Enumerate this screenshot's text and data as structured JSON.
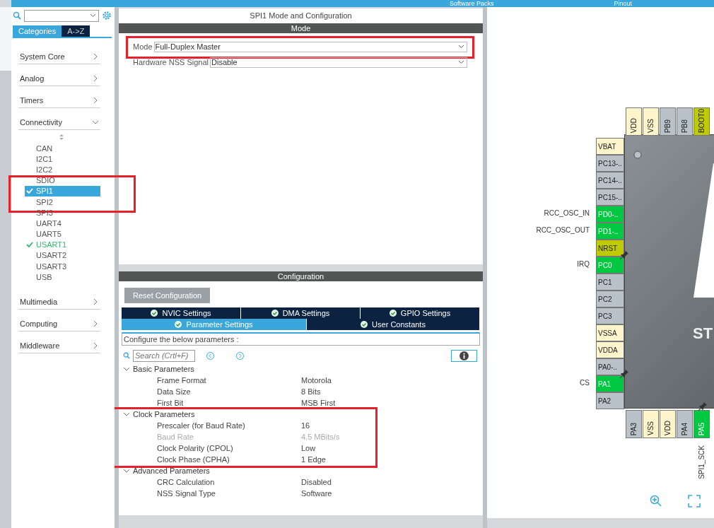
{
  "top_bar": {
    "menus": [
      "Software Packs",
      "Pinout"
    ]
  },
  "sidebar": {
    "tabs": [
      {
        "label": "Categories",
        "selected": true
      },
      {
        "label": "A->Z",
        "selected": false
      }
    ],
    "categories": [
      {
        "label": "System Core",
        "expanded": false
      },
      {
        "label": "Analog",
        "expanded": false
      },
      {
        "label": "Timers",
        "expanded": false
      },
      {
        "label": "Connectivity",
        "expanded": true,
        "children": [
          {
            "label": "CAN",
            "selected": false,
            "checked": false,
            "highlighted": false
          },
          {
            "label": "I2C1",
            "selected": false,
            "checked": false,
            "highlighted": false
          },
          {
            "label": "I2C2",
            "selected": false,
            "checked": false,
            "highlighted": false
          },
          {
            "label": "SDIO",
            "selected": false,
            "checked": false,
            "highlighted": false
          },
          {
            "label": "SPI1",
            "selected": true,
            "checked": true,
            "highlighted": true
          },
          {
            "label": "SPI2",
            "selected": false,
            "checked": false,
            "highlighted": false
          },
          {
            "label": "SPI3",
            "selected": false,
            "checked": false,
            "highlighted": false
          },
          {
            "label": "UART4",
            "selected": false,
            "checked": false,
            "highlighted": false
          },
          {
            "label": "UART5",
            "selected": false,
            "checked": false,
            "highlighted": false
          },
          {
            "label": "USART1",
            "selected": false,
            "checked": true,
            "highlighted": false
          },
          {
            "label": "USART2",
            "selected": false,
            "checked": false,
            "highlighted": false
          },
          {
            "label": "USART3",
            "selected": false,
            "checked": false,
            "highlighted": false
          },
          {
            "label": "USB",
            "selected": false,
            "checked": false,
            "highlighted": false
          }
        ]
      },
      {
        "label": "Multimedia",
        "expanded": false
      },
      {
        "label": "Computing",
        "expanded": false
      },
      {
        "label": "Middleware",
        "expanded": false
      }
    ]
  },
  "panel": {
    "title": "SPI1 Mode and Configuration",
    "mode_header": "Mode",
    "mode_fields": [
      {
        "label": "Mode",
        "value": "Full-Duplex Master",
        "highlighted": true
      },
      {
        "label": "Hardware NSS Signal",
        "value": "Disable",
        "highlighted": false
      }
    ],
    "config_header": "Configuration",
    "reset_button": "Reset Configuration",
    "tab_rows": [
      [
        {
          "label": "NVIC Settings",
          "selected": false
        },
        {
          "label": "DMA Settings",
          "selected": false
        },
        {
          "label": "GPIO Settings",
          "selected": false
        }
      ],
      [
        {
          "label": "Parameter Settings",
          "selected": true
        },
        {
          "label": "User Constants",
          "selected": false
        }
      ]
    ],
    "hint": "Configure the below parameters :",
    "search": {
      "placeholder": "Search (Crtl+F)"
    },
    "groups": [
      {
        "label": "Basic Parameters",
        "expanded": true,
        "highlighted": false,
        "children": [
          {
            "label": "Frame Format",
            "value": "Motorola",
            "disabled": false
          },
          {
            "label": "Data Size",
            "value": "8 Bits",
            "disabled": false
          },
          {
            "label": "First Bit",
            "value": "MSB First",
            "disabled": false
          }
        ]
      },
      {
        "label": "Clock Parameters",
        "expanded": true,
        "highlighted": true,
        "children": [
          {
            "label": "Prescaler (for Baud Rate)",
            "value": "16",
            "disabled": false
          },
          {
            "label": "Baud Rate",
            "value": "4.5 MBits/s",
            "disabled": true
          },
          {
            "label": "Clock Polarity (CPOL)",
            "value": "Low",
            "disabled": false
          },
          {
            "label": "Clock Phase (CPHA)",
            "value": "1 Edge",
            "disabled": false
          }
        ]
      },
      {
        "label": "Advanced Parameters",
        "expanded": true,
        "highlighted": false,
        "children": [
          {
            "label": "CRC Calculation",
            "value": "Disabled",
            "disabled": false
          },
          {
            "label": "NSS Signal Type",
            "value": "Software",
            "disabled": false
          }
        ]
      }
    ]
  },
  "pinout": {
    "chip_text": "ST",
    "top_pins": [
      {
        "label": "VDD",
        "kind": "power"
      },
      {
        "label": "VSS",
        "kind": "power"
      },
      {
        "label": "PB9",
        "kind": "io"
      },
      {
        "label": "PB8",
        "kind": "io"
      },
      {
        "label": "BOOT0",
        "kind": "boot"
      }
    ],
    "left_pins": [
      {
        "label": "VBAT",
        "kind": "power"
      },
      {
        "label": "PC13-..",
        "kind": "io"
      },
      {
        "label": "PC14-..",
        "kind": "io"
      },
      {
        "label": "PC15-..",
        "kind": "io"
      },
      {
        "label": "PD0-..",
        "kind": "used",
        "signal": "RCC_OSC_IN"
      },
      {
        "label": "PD1-..",
        "kind": "used",
        "signal": "RCC_OSC_OUT"
      },
      {
        "label": "NRST",
        "kind": "boot"
      },
      {
        "label": "PC0",
        "kind": "used",
        "signal": "IRQ",
        "pinned": true
      },
      {
        "label": "PC1",
        "kind": "io"
      },
      {
        "label": "PC2",
        "kind": "io"
      },
      {
        "label": "PC3",
        "kind": "io"
      },
      {
        "label": "VSSA",
        "kind": "power"
      },
      {
        "label": "VDDA",
        "kind": "power"
      },
      {
        "label": "PA0-..",
        "kind": "io"
      },
      {
        "label": "PA1",
        "kind": "used",
        "signal": "CS",
        "pinned": true
      },
      {
        "label": "PA2",
        "kind": "io"
      }
    ],
    "bottom_pins": [
      {
        "label": "PA3",
        "kind": "io"
      },
      {
        "label": "VSS",
        "kind": "power"
      },
      {
        "label": "VDD",
        "kind": "power"
      },
      {
        "label": "PA4",
        "kind": "io"
      },
      {
        "label": "PA5",
        "kind": "used",
        "signal": "SPI1_SCK",
        "pinned": true
      }
    ]
  }
}
